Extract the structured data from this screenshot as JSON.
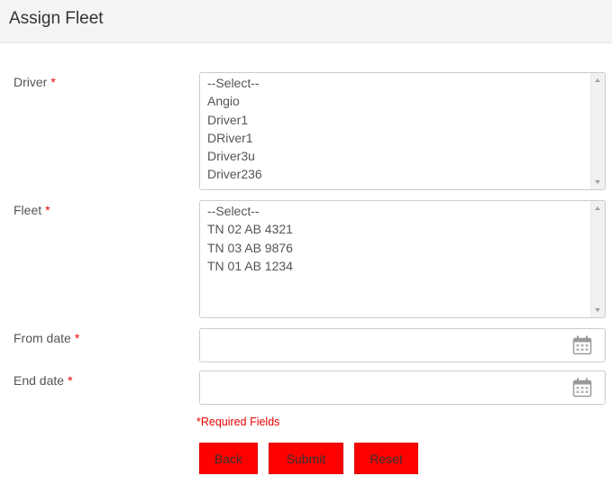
{
  "header": {
    "title": "Assign Fleet"
  },
  "form": {
    "required_marker": "*",
    "driver": {
      "label": "Driver",
      "options": [
        "--Select--",
        "Angio",
        "Driver1",
        "DRiver1",
        "Driver3u",
        "Driver236"
      ]
    },
    "fleet": {
      "label": "Fleet",
      "options": [
        "--Select--",
        "TN 02 AB 4321",
        "TN 03 AB 9876",
        "TN 01 AB 1234"
      ]
    },
    "from_date": {
      "label": "From date",
      "value": "",
      "icon": "calendar-icon"
    },
    "end_date": {
      "label": "End date",
      "value": "",
      "icon": "calendar-icon"
    },
    "required_note": "*Required Fields"
  },
  "buttons": {
    "back": "Back",
    "submit": "Submit",
    "reset": "Reset"
  },
  "colors": {
    "accent": "#ff0000",
    "required": "#e60000",
    "header_bg": "#f5f5f5"
  }
}
